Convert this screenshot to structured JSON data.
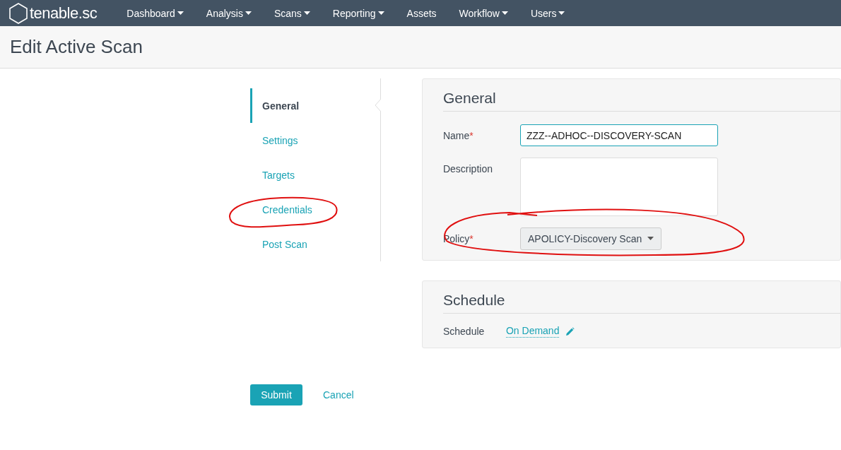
{
  "navbar": {
    "logo": "tenable.sc",
    "items": [
      {
        "label": "Dashboard",
        "dropdown": true
      },
      {
        "label": "Analysis",
        "dropdown": true
      },
      {
        "label": "Scans",
        "dropdown": true
      },
      {
        "label": "Reporting",
        "dropdown": true
      },
      {
        "label": "Assets",
        "dropdown": false
      },
      {
        "label": "Workflow",
        "dropdown": true
      },
      {
        "label": "Users",
        "dropdown": true
      }
    ]
  },
  "page_title": "Edit Active Scan",
  "side_nav": [
    {
      "label": "General",
      "selected": true
    },
    {
      "label": "Settings",
      "selected": false
    },
    {
      "label": "Targets",
      "selected": false
    },
    {
      "label": "Credentials",
      "selected": false
    },
    {
      "label": "Post Scan",
      "selected": false
    }
  ],
  "general": {
    "title": "General",
    "fields": [
      {
        "kind": "text",
        "label": "Name",
        "required_mark": "*",
        "value": "ZZZ--ADHOC--DISCOVERY-SCAN"
      },
      {
        "kind": "textarea",
        "label": "Description"
      },
      {
        "kind": "select",
        "label": "Policy",
        "required_mark": "*",
        "value": "APOLICY-Discovery Scan"
      }
    ]
  },
  "schedule": {
    "title": "Schedule",
    "label": "Schedule",
    "value": "On Demand"
  },
  "buttons": {
    "submit": "Submit",
    "cancel": "Cancel"
  }
}
